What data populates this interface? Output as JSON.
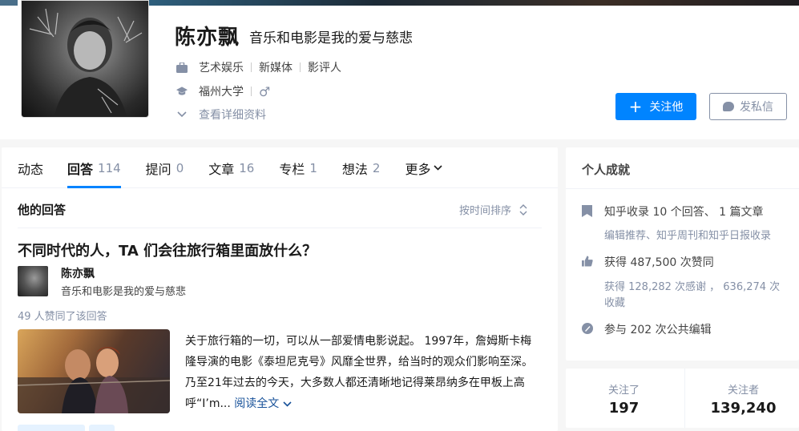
{
  "profile": {
    "name": "陈亦飘",
    "headline": "音乐和电影是我的爱与慈悲",
    "industry": [
      "艺术娱乐",
      "新媒体",
      "影评人"
    ],
    "school": "福州大学",
    "gender_symbol": "♂",
    "details_link": "查看详细资料",
    "follow_button": "关注他",
    "message_button": "发私信"
  },
  "tabs": [
    {
      "label": "动态",
      "count": ""
    },
    {
      "label": "回答",
      "count": "114"
    },
    {
      "label": "提问",
      "count": "0"
    },
    {
      "label": "文章",
      "count": "16"
    },
    {
      "label": "专栏",
      "count": "1"
    },
    {
      "label": "想法",
      "count": "2"
    },
    {
      "label": "更多",
      "count": ""
    }
  ],
  "answers": {
    "section_title": "他的回答",
    "sort_label": "按时间排序",
    "item": {
      "question": "不同时代的人，TA 们会往旅行箱里面放什么？",
      "author_name": "陈亦飘",
      "author_bio": "音乐和电影是我的爱与慈悲",
      "votes": "49 人赞同了该回答",
      "excerpt": "关于旅行箱的一切，可以从一部爱情电影说起。 1997年，詹姆斯卡梅隆导演的电影《泰坦尼克号》风靡全世界，给当时的观众们影响至深。乃至21年过去的今天，大多数人都还清晰地记得莱昂纳多在甲板上高呼“I’m...",
      "read_more": "阅读全文"
    }
  },
  "achievements": {
    "title": "个人成就",
    "collect": "知乎收录 10 个回答、 1 篇文章",
    "collect_sub": "编辑推荐、知乎周刊和知乎日报收录",
    "likes": "获得 487,500 次赞同",
    "thanks": "获得 128,282 次感谢 ， 636,274 次收藏",
    "edits": "参与 202 次公共编辑"
  },
  "stats": {
    "following_label": "关注了",
    "following": "197",
    "followers_label": "关注者",
    "followers": "139,240"
  },
  "colors": {
    "primary": "#0084ff",
    "muted": "#8590a6",
    "link": "#175199"
  }
}
